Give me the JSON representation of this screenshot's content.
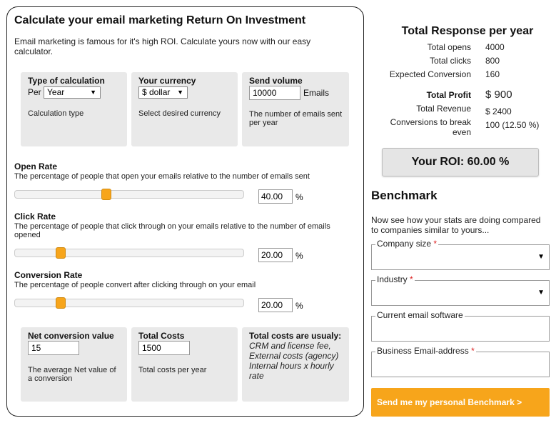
{
  "calculator": {
    "title": "Calculate your email marketing Return On Investment",
    "intro": "Email marketing is famous for it's high ROI. Calculate yours now with our easy calculator.",
    "calc_type": {
      "label": "Type of calculation",
      "per_label": "Per",
      "value": "Year",
      "help": "Calculation type"
    },
    "currency": {
      "label": "Your currency",
      "value": "$ dollar",
      "help": "Select desired currency"
    },
    "send_volume": {
      "label": "Send volume",
      "value": "10000",
      "unit": "Emails",
      "help": "The number of emails sent per year"
    },
    "open_rate": {
      "title": "Open Rate",
      "desc": "The percentage of people that open your emails relative to the number of emails sent",
      "value": "40.00",
      "slider_fraction": 0.4,
      "unit": "%"
    },
    "click_rate": {
      "title": "Click Rate",
      "desc": "The percentage of people that click through on your emails relative to the number of emails opened",
      "value": "20.00",
      "slider_fraction": 0.2,
      "unit": "%"
    },
    "conversion_rate": {
      "title": "Conversion Rate",
      "desc": "The percentage of people convert after clicking through on your email",
      "value": "20.00",
      "slider_fraction": 0.2,
      "unit": "%"
    },
    "net_value": {
      "label": "Net conversion value",
      "value": "15",
      "help": "The average Net value of a conversion"
    },
    "total_costs": {
      "label": "Total Costs",
      "value": "1500",
      "help": "Total costs per year"
    },
    "costs_note": {
      "label": "Total costs are usualy:",
      "text": "CRM and license fee, External costs (agency) Internal hours x hourly rate"
    }
  },
  "response": {
    "title": "Total Response per year",
    "rows": [
      {
        "label": "Total opens",
        "value": "4000"
      },
      {
        "label": "Total clicks",
        "value": "800"
      },
      {
        "label": "Expected Conversion",
        "value": "160"
      }
    ],
    "profit": {
      "label": "Total Profit",
      "value": "$ 900"
    },
    "revenue": {
      "label": "Total Revenue",
      "value": "$ 2400"
    },
    "break_even": {
      "label": "Conversions to break even",
      "value": "100 (12.50 %)"
    },
    "roi": "Your ROI: 60.00 %"
  },
  "benchmark": {
    "title": "Benchmark",
    "intro": "Now see how your stats are doing compared to companies similar to yours...",
    "fields": [
      {
        "label": "Company size",
        "required": "*"
      },
      {
        "label": "Industry",
        "required": "*"
      },
      {
        "label": "Current email software",
        "required": ""
      },
      {
        "label": "Business Email-address",
        "required": "*"
      }
    ],
    "submit": "Send me my personal Benchmark >"
  },
  "colors": {
    "accent": "#f7a51b",
    "panel": "#e9e9e9",
    "required": "#d22222"
  }
}
